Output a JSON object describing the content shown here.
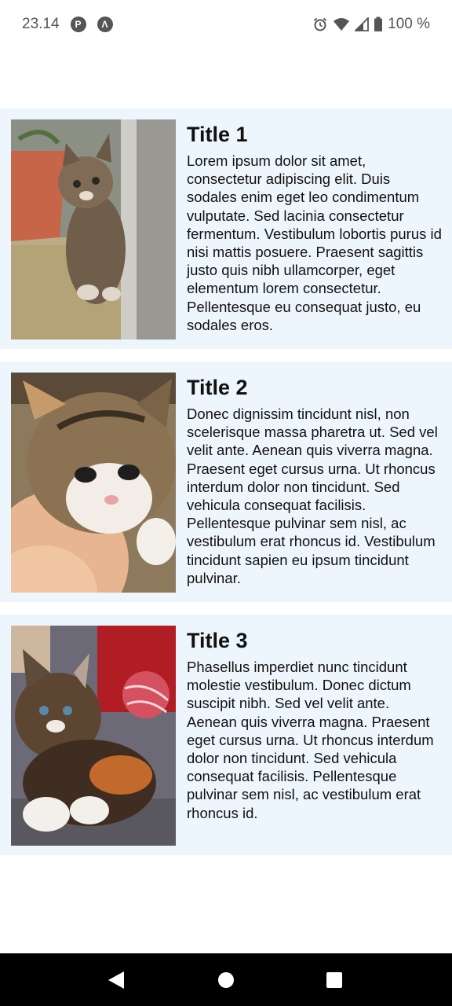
{
  "status_bar": {
    "time": "23.14",
    "battery": "100 %",
    "icons": [
      "p-app-icon",
      "a-app-icon",
      "alarm-icon",
      "wifi-icon",
      "signal-icon",
      "battery-icon"
    ]
  },
  "items": [
    {
      "title": "Title 1",
      "text": "Lorem ipsum dolor sit amet, consectetur adipiscing elit. Duis sodales enim eget leo condimentum vulputate. Sed lacinia consectetur fermentum. Vestibulum lobortis purus id nisi mattis posuere. Praesent sagittis justo quis nibh ullamcorper, eget elementum lorem consectetur. Pellentesque eu consequat justo, eu sodales eros.",
      "image": "kitten-photo"
    },
    {
      "title": "Title 2",
      "text": "Donec dignissim tincidunt nisl, non scelerisque massa pharetra ut. Sed vel velit ante. Aenean quis viverra magna. Praesent eget cursus urna. Ut rhoncus interdum dolor non tincidunt. Sed vehicula consequat facilisis. Pellentesque pulvinar sem nisl, ac vestibulum erat rhoncus id. Vestibulum tincidunt sapien eu ipsum tincidunt pulvinar.",
      "image": "kitten-photo"
    },
    {
      "title": "Title 3",
      "text": "Phasellus imperdiet nunc tincidunt molestie vestibulum. Donec dictum suscipit nibh. Sed vel velit ante. Aenean quis viverra magna. Praesent eget cursus urna. Ut rhoncus interdum dolor non tincidunt. Sed vehicula consequat facilisis. Pellentesque pulvinar sem nisl, ac vestibulum erat rhoncus id.",
      "image": "kitten-photo"
    }
  ],
  "navigation": {
    "buttons": [
      "back-icon",
      "home-icon",
      "recents-icon"
    ]
  },
  "colors": {
    "card_background": "#eef6fd",
    "nav_bar": "#000000",
    "text": "#111111"
  }
}
